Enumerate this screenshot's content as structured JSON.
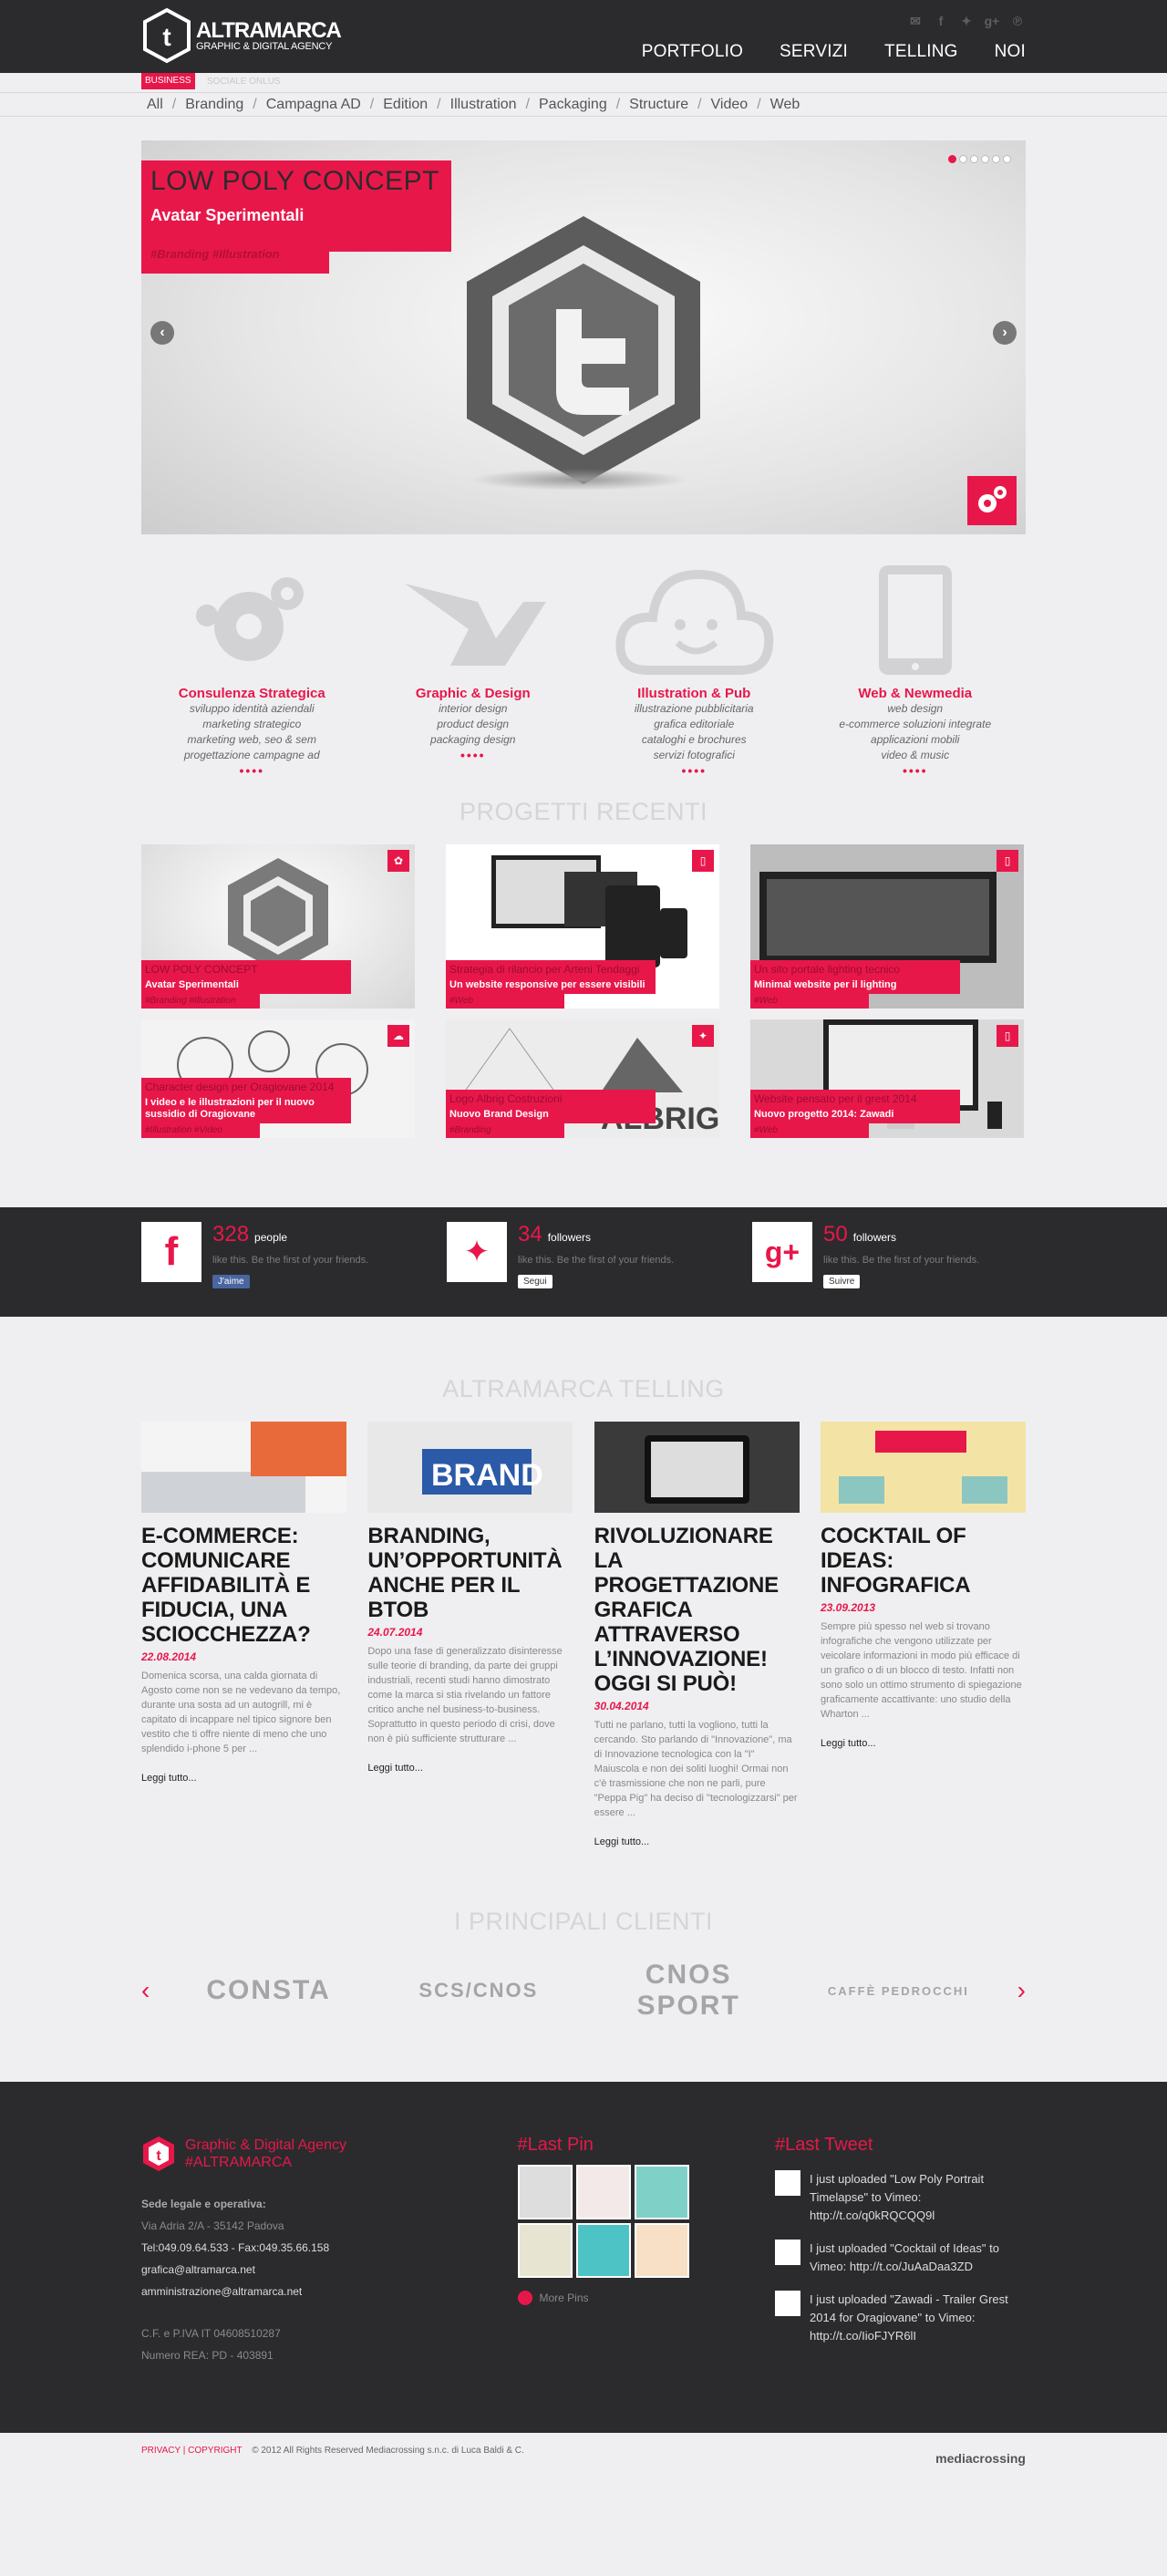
{
  "brand": {
    "name": "ALTRAMARCA",
    "tagline": "GRAPHIC & DIGITAL AGENCY"
  },
  "nav": [
    "PORTFOLIO",
    "SERVIZI",
    "TELLING",
    "NOI"
  ],
  "subbar": {
    "active": "BUSINESS",
    "other": "SOCIALE ONLUS"
  },
  "filters": [
    "All",
    "Branding",
    "Campagna AD",
    "Edition",
    "Illustration",
    "Packaging",
    "Structure",
    "Video",
    "Web"
  ],
  "hero": {
    "title": "LOW POLY CONCEPT",
    "subtitle": "Avatar Sperimentali",
    "tags": "#Branding #Illustration",
    "dots": 6,
    "active_dot": 1
  },
  "services": [
    {
      "icon": "gears-icon",
      "title": "Consulenza Strategica",
      "lines": [
        "sviluppo identità aziendali",
        "marketing strategico",
        "marketing web, seo & sem",
        "progettazione campagne ad"
      ],
      "more": "••••"
    },
    {
      "icon": "origami-bird-icon",
      "title": "Graphic & Design",
      "lines": [
        "interior design",
        "product design",
        "packaging design"
      ],
      "more": "••••"
    },
    {
      "icon": "cloud-smile-icon",
      "title": "Illustration & Pub",
      "lines": [
        "illustrazione pubblicitaria",
        "grafica editoriale",
        "cataloghi e brochures",
        "servizi fotografici"
      ],
      "more": "••••"
    },
    {
      "icon": "tablet-icon",
      "title": "Web & Newmedia",
      "lines": [
        "web design",
        "e-commerce soluzioni integrate",
        "applicazioni mobili",
        "video & music"
      ],
      "more": "••••"
    }
  ],
  "projects_title": "PROGETTI RECENTI",
  "projects": [
    {
      "title": "LOW POLY CONCEPT",
      "subtitle": "Avatar Sperimentali",
      "tags": "#Branding #Illustration",
      "badge": "gear-icon"
    },
    {
      "title": "Strategia di rilancio per Arteni Tendaggi",
      "subtitle": "Un website responsive per essere visibili",
      "tags": "#Web",
      "badge": "tablet-icon"
    },
    {
      "title": "Un sito portale lighting tecnico",
      "subtitle": "Minimal website per il lighting",
      "tags": "#Web",
      "badge": "tablet-icon"
    },
    {
      "title": "Character design per Oragiovane 2014",
      "subtitle": "I video e le illustrazioni per il nuovo sussidio di Oragiovane",
      "tags": "#Illustration #Video",
      "badge": "cloud-icon"
    },
    {
      "title": "Logo Albrig Costruzioni",
      "subtitle": "Nuovo Brand Design",
      "tags": "#Branding",
      "badge": "bird-icon"
    },
    {
      "title": "Website pensato per il grest 2014",
      "subtitle": "Nuovo progetto 2014: Zawadi",
      "tags": "#Web",
      "badge": "tablet-icon"
    }
  ],
  "stats": [
    {
      "icon": "facebook-icon",
      "num": "328",
      "unit": "people",
      "desc": "like this. Be the first of your friends.",
      "btn": "J'aime"
    },
    {
      "icon": "twitter-icon",
      "num": "34",
      "unit": "followers",
      "desc": "like this. Be the first of your friends.",
      "btn": "Segui"
    },
    {
      "icon": "googleplus-icon",
      "num": "50",
      "unit": "followers",
      "desc": "like this. Be the first of your friends.",
      "btn": "Suivre"
    }
  ],
  "telling_title": "ALTRAMARCA TELLING",
  "posts": [
    {
      "title": "E-COMMERCE: COMUNICARE AFFIDABILITÀ E FIDUCIA, UNA SCIOCCHEZZA?",
      "date": "22.08.2014",
      "text": "Domenica scorsa, una calda giornata di Agosto come non se ne vedevano da tempo, durante una sosta ad un autogrill, mi è capitato di incappare nel tipico signore ben vestito che ti offre niente di meno che uno splendido i-phone 5 per ...",
      "more": "Leggi tutto..."
    },
    {
      "title": "BRANDING, UN’OPPORTUNITÀ ANCHE PER IL BTOB",
      "date": "24.07.2014",
      "text": "Dopo una fase di generalizzato disinteresse sulle teorie di branding, da parte dei gruppi industriali, recenti studi hanno dimostrato come la marca si stia rivelando un fattore critico anche nel business-to-business. Soprattutto in questo periodo di crisi, dove non è più sufficiente strutturare ...",
      "more": "Leggi tutto..."
    },
    {
      "title": "RIVOLUZIONARE LA PROGETTAZIONE GRAFICA ATTRAVERSO L’INNOVAZIONE! OGGI SI PUÒ!",
      "date": "30.04.2014",
      "text": "Tutti ne parlano, tutti la vogliono, tutti la cercando. Sto parlando di \"Innovazione\", ma di Innovazione tecnologica con la \"I\" Maiuscola e non dei soliti luoghi! Ormai non c'è trasmissione che non ne parli, pure \"Peppa Pig\" ha deciso di \"tecnologizzarsi\" per essere ...",
      "more": "Leggi tutto..."
    },
    {
      "title": "COCKTAIL OF IDEAS: INFOGRAFICA",
      "date": "23.09.2013",
      "text": "Sempre più spesso nel web si trovano infografiche che vengono utilizzate per veicolare informazioni in modo più efficace di un grafico o di un blocco di testo. Infatti non sono solo un ottimo strumento di spiegazione graficamente accattivante: uno studio della Wharton ...",
      "more": "Leggi tutto..."
    }
  ],
  "clients_title": "I PRINCIPALI CLIENTI",
  "clients": [
    "CONSTA",
    "SCS/CNOS",
    "CNOS SPORT",
    "CAFFÈ PEDROCCHI"
  ],
  "footer": {
    "brand1": "Graphic & Digital Agency",
    "brand2": "#ALTRAMARCA",
    "sede": "Sede legale e operativa:",
    "address": "Via Adria 2/A - 35142 Padova",
    "tel": "Tel:049.09.64.533 - Fax:049.35.66.158",
    "email1": "grafica@altramarca.net",
    "email2": "amministrazione@altramarca.net",
    "piva": "C.F. e P.IVA IT 04608510287",
    "rea": "Numero REA: PD - 403891",
    "pin_title": "#Last Pin",
    "pin_more": "More Pins",
    "tweet_title": "#Last Tweet",
    "tweets": [
      "I just uploaded \"Low Poly Portrait Timelapse\" to Vimeo: http://t.co/q0kRQCQQ9l",
      "I just uploaded \"Cocktail of Ideas\" to Vimeo: http://t.co/JuAaDaa3ZD",
      "I just uploaded \"Zawadi - Trailer Grest 2014 for Oragiovane\" to Vimeo: http://t.co/IioFJYR6lI"
    ]
  },
  "bottom": {
    "privacy": "PRIVACY | COPYRIGHT",
    "rights": "© 2012 All Rights Reserved Mediacrossing s.n.c. di Luca Baldi & C.",
    "credit": "mediacrossing"
  }
}
